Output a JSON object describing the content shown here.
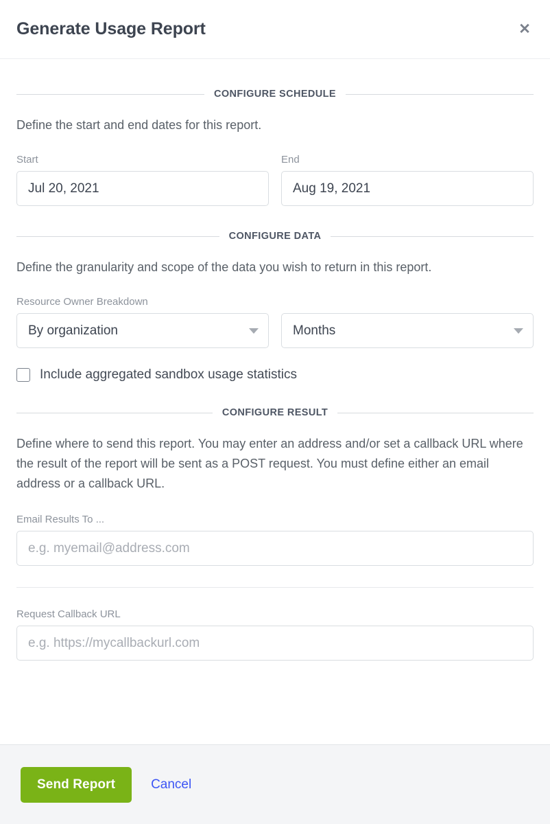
{
  "dialog": {
    "title": "Generate Usage Report",
    "close_icon": "close-icon",
    "close_glyph": "✕"
  },
  "sections": {
    "schedule": {
      "legend": "CONFIGURE SCHEDULE",
      "description": "Define the start and end dates for this report.",
      "start": {
        "label": "Start",
        "value": "Jul 20, 2021"
      },
      "end": {
        "label": "End",
        "value": "Aug 19, 2021"
      }
    },
    "data": {
      "legend": "CONFIGURE DATA",
      "description": "Define the granularity and scope of the data you wish to return in this report.",
      "breakdown": {
        "label": "Resource Owner Breakdown",
        "value": "By organization"
      },
      "granularity": {
        "value": "Months"
      },
      "sandbox_checkbox": {
        "label": "Include aggregated sandbox usage statistics",
        "checked": false
      }
    },
    "result": {
      "legend": "CONFIGURE RESULT",
      "description": "Define where to send this report. You may enter an address and/or set a callback URL where the result of the report will be sent as a POST request. You must define either an email address or a callback URL.",
      "email": {
        "label": "Email Results To ...",
        "value": "",
        "placeholder": "e.g. myemail@address.com"
      },
      "callback": {
        "label": "Request Callback URL",
        "value": "",
        "placeholder": "e.g. https://mycallbackurl.com"
      }
    }
  },
  "footer": {
    "submit_label": "Send Report",
    "cancel_label": "Cancel",
    "submit_color": "#7ab317",
    "cancel_color": "#3c55f5"
  }
}
